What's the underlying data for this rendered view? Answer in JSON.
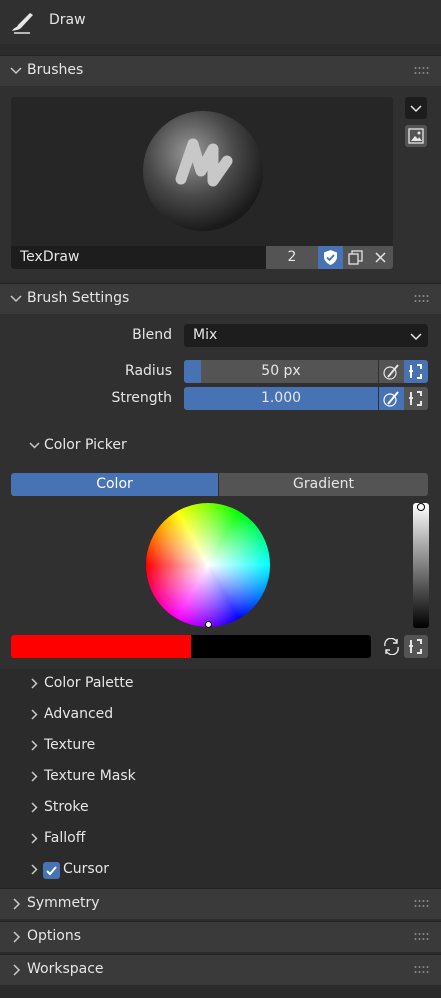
{
  "header": {
    "tool_name": "Draw",
    "icon": "brush-icon"
  },
  "brushes": {
    "title": "Brushes",
    "brush_name": "TexDraw",
    "user_count": "2"
  },
  "brush_settings": {
    "title": "Brush Settings",
    "blend_label": "Blend",
    "blend_value": "Mix",
    "radius_label": "Radius",
    "radius_value": "50 px",
    "radius_fill": 0.09,
    "strength_label": "Strength",
    "strength_value": "1.000",
    "strength_fill": 1.0
  },
  "color_picker": {
    "title": "Color Picker",
    "tabs": [
      "Color",
      "Gradient"
    ],
    "active_tab": "Color",
    "primary_color": "#ff0000",
    "secondary_color": "#000000"
  },
  "subpanels": [
    {
      "label": "Color Palette"
    },
    {
      "label": "Advanced"
    },
    {
      "label": "Texture"
    },
    {
      "label": "Texture Mask"
    },
    {
      "label": "Stroke"
    },
    {
      "label": "Falloff"
    },
    {
      "label": "Cursor",
      "checked": true
    }
  ],
  "bottom_panels": [
    {
      "label": "Symmetry"
    },
    {
      "label": "Options"
    },
    {
      "label": "Workspace"
    }
  ],
  "colors": {
    "accent": "#4772b3",
    "panel_bg": "#303030",
    "header_bg": "#3a3a3a"
  }
}
